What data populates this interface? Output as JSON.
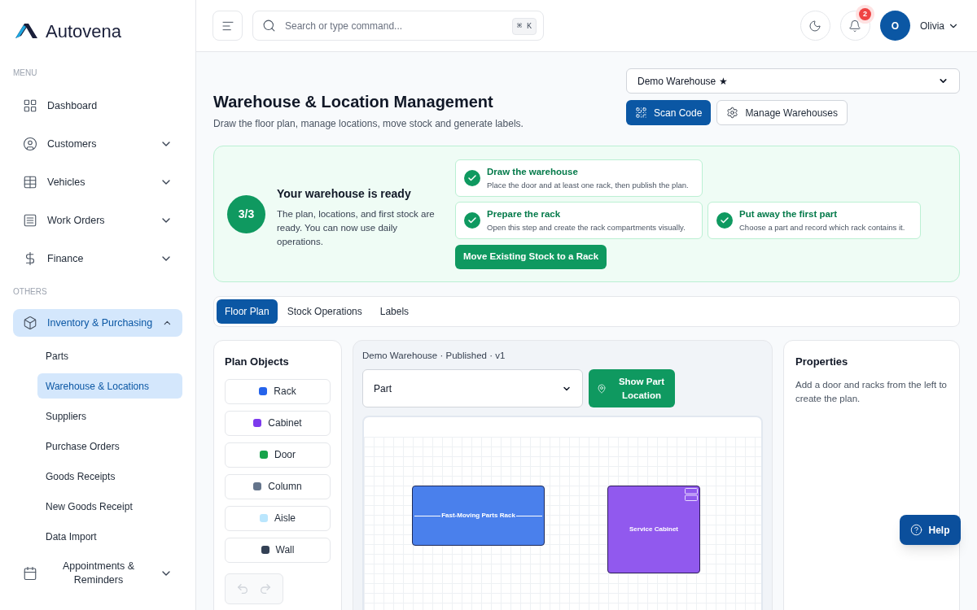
{
  "brand": {
    "name": "Autovena"
  },
  "sidebar": {
    "sections": [
      {
        "title": "MENU",
        "items": [
          {
            "label": "Dashboard",
            "selected": false
          },
          {
            "label": "Customers",
            "selected": false,
            "expanded": false
          },
          {
            "label": "Vehicles",
            "selected": false,
            "expanded": false
          },
          {
            "label": "Work Orders",
            "selected": false,
            "expanded": false
          },
          {
            "label": "Finance",
            "selected": false,
            "expanded": false
          }
        ]
      },
      {
        "title": "OTHERS",
        "items": [
          {
            "label": "Inventory & Purchasing",
            "selected": true,
            "expanded": true,
            "children": [
              {
                "label": "Parts",
                "selected": false
              },
              {
                "label": "Warehouse & Locations",
                "selected": true
              },
              {
                "label": "Suppliers",
                "selected": false
              },
              {
                "label": "Purchase Orders",
                "selected": false
              },
              {
                "label": "Goods Receipts",
                "selected": false
              },
              {
                "label": "New Goods Receipt",
                "selected": false
              },
              {
                "label": "Data Import",
                "selected": false
              }
            ]
          },
          {
            "label": "Appointments & Reminders",
            "selected": false,
            "expanded": false
          }
        ]
      }
    ]
  },
  "header": {
    "search": {
      "placeholder": "Search or type command...",
      "shortcut": "⌘ K"
    },
    "notifications": {
      "count": "2"
    },
    "user": {
      "initial": "O",
      "name": "Olivia"
    }
  },
  "page": {
    "title": "Warehouse & Location Management",
    "subtitle": "Draw the floor plan, manage locations, move stock and generate labels.",
    "warehouse_select": {
      "value": "Demo Warehouse ★"
    },
    "buttons": [
      {
        "label": "Scan Code",
        "kind": "primary"
      },
      {
        "label": "Manage Warehouses",
        "kind": "secondary"
      }
    ]
  },
  "setup": {
    "progress": "3/3",
    "title": "Your warehouse is ready",
    "text": "The plan, locations, and first stock are ready. You can now use daily operations.",
    "steps": [
      {
        "title": "Draw the warehouse",
        "text": "Place the door and at least one rack, then publish the plan.",
        "done": true
      },
      {
        "title": "Prepare the rack",
        "text": "Open this step and create the rack compartments visually.",
        "done": true
      },
      {
        "title": "Put away the first part",
        "text": "Choose a part and record which rack contains it.",
        "done": true
      }
    ],
    "action": "Move Existing Stock to a Rack"
  },
  "tabs": [
    {
      "label": "Floor Plan",
      "selected": true
    },
    {
      "label": "Stock Operations",
      "selected": false
    },
    {
      "label": "Labels",
      "selected": false
    }
  ],
  "plan_objects": {
    "title": "Plan Objects",
    "items": [
      {
        "label": "Rack",
        "color": "#2563eb"
      },
      {
        "label": "Cabinet",
        "color": "#7c3aed"
      },
      {
        "label": "Door",
        "color": "#16a34a"
      },
      {
        "label": "Column",
        "color": "#64748b"
      },
      {
        "label": "Aisle",
        "color": "#bae6fd"
      },
      {
        "label": "Wall",
        "color": "#334155"
      }
    ],
    "undo": {
      "disabled": true
    },
    "redo": {
      "disabled": true
    }
  },
  "canvas": {
    "status": "Demo Warehouse · Published · v1",
    "part_select": {
      "value": "Part"
    },
    "locate_button": "Show Part Location",
    "objects": [
      {
        "kind": "rack",
        "label": "Fast-Moving Parts Rack"
      },
      {
        "kind": "cabinet",
        "label": "Service Cabinet"
      }
    ]
  },
  "properties": {
    "title": "Properties",
    "text": "Add a door and racks from the left to create the plan."
  },
  "help_button": "Help"
}
